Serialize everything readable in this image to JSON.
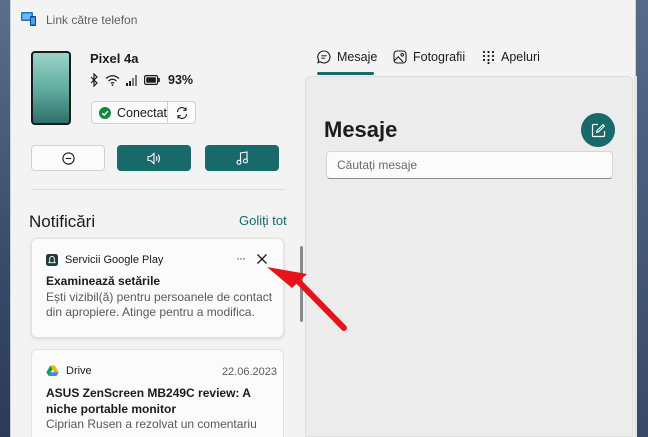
{
  "window": {
    "title": "Link către telefon"
  },
  "device": {
    "name": "Pixel 4a",
    "battery": "93%",
    "connection_label": "Conectat"
  },
  "notifications": {
    "heading": "Notificări",
    "clear_all": "Goliți tot",
    "items": [
      {
        "app": "Servicii Google Play",
        "title": "Examinează setările",
        "body": "Ești vizibil(ă) pentru persoanele de contact din apropiere. Atinge pentru a modifica.",
        "date": ""
      },
      {
        "app": "Drive",
        "title": "ASUS ZenScreen MB249C review: A niche portable monitor",
        "body": "Ciprian Rusen a rezolvat un comentariu",
        "date": "22.06.2023"
      }
    ]
  },
  "tabs": [
    {
      "label": "Mesaje",
      "icon": "chat-icon",
      "active": true
    },
    {
      "label": "Fotografii",
      "icon": "photos-icon",
      "active": false
    },
    {
      "label": "Apeluri",
      "icon": "dialpad-icon",
      "active": false
    }
  ],
  "messages": {
    "title": "Mesaje",
    "search_placeholder": "Căutați mesaje"
  },
  "colors": {
    "accent": "#186a6a",
    "link": "#0f6b74",
    "connected_green": "#10893e",
    "annotation_arrow": "#e5141b"
  }
}
